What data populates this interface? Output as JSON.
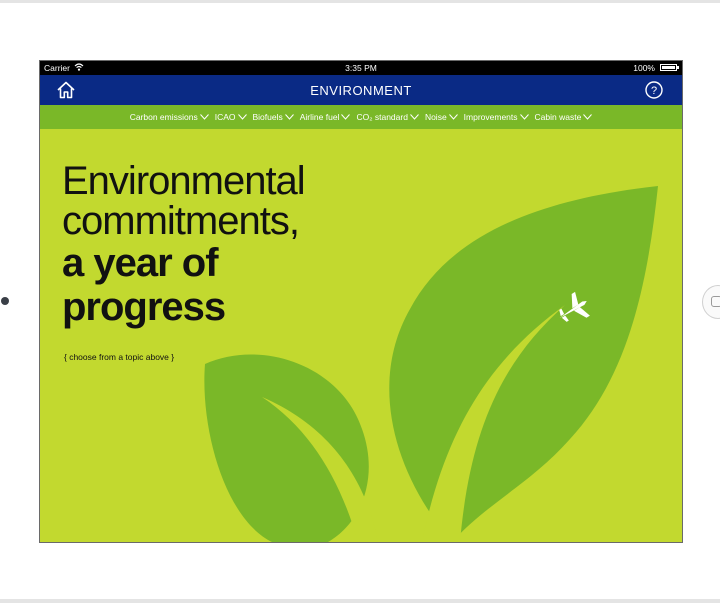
{
  "status_bar": {
    "carrier": "Carrier",
    "time": "3:35 PM",
    "battery": "100%"
  },
  "nav": {
    "title": "ENVIRONMENT",
    "home_icon": "home-icon",
    "help_icon": "help-icon"
  },
  "topics": [
    {
      "label": "Carbon emissions"
    },
    {
      "label": "ICAO"
    },
    {
      "label": "Biofuels"
    },
    {
      "label": "Airline fuel"
    },
    {
      "label": "CO₂ standard"
    },
    {
      "label": "Noise"
    },
    {
      "label": "Improvements"
    },
    {
      "label": "Cabin waste"
    }
  ],
  "hero": {
    "line1": "Environmental",
    "line2": "commitments,",
    "line3": "a year of",
    "line4": "progress",
    "subtitle": "{ choose from a topic above }"
  },
  "colors": {
    "background": "#c2d92f",
    "topic_bar": "#7ab828",
    "nav_bar": "#0a2a85",
    "leaf_dark": "#7ab828",
    "leaf_light": "#c2d92f"
  }
}
